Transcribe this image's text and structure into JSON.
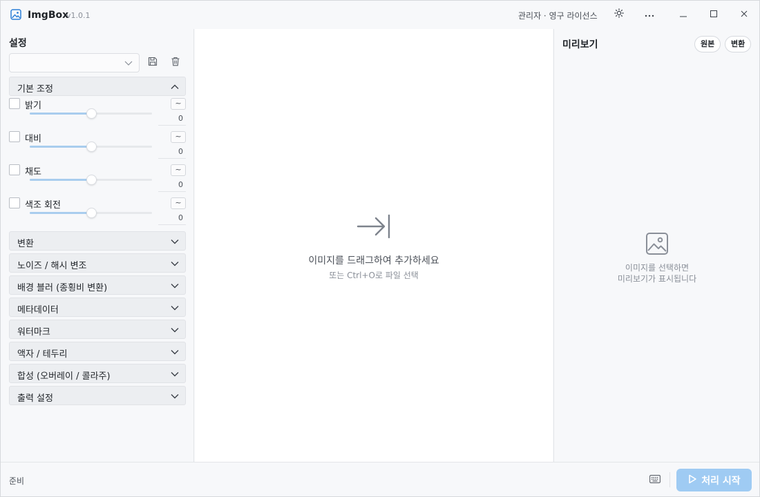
{
  "app": {
    "name": "ImgBox",
    "version": "v1.0.1",
    "license": "관리자 · 영구 라이선스",
    "icons": {
      "app": "image-icon",
      "theme": "sun-icon",
      "more": "more-icon",
      "minimize": "minimize-icon",
      "maximize": "maximize-icon",
      "close": "close-icon"
    }
  },
  "settings": {
    "title": "설정",
    "preset_value": "",
    "adjust_section": {
      "label": "기본 조정",
      "expanded": true,
      "items": [
        {
          "label": "밝기",
          "checked": false,
          "value": "0",
          "level": 0.5,
          "reset": "~"
        },
        {
          "label": "대비",
          "checked": false,
          "value": "0",
          "level": 0.5,
          "reset": "~"
        },
        {
          "label": "채도",
          "checked": false,
          "value": "0",
          "level": 0.5,
          "reset": "~"
        },
        {
          "label": "색조 회전",
          "checked": false,
          "value": "0",
          "level": 0.5,
          "reset": "~"
        }
      ]
    },
    "sections": [
      {
        "label": "변환"
      },
      {
        "label": "노이즈 / 해시 변조"
      },
      {
        "label": "배경 블러 (종횡비 변환)"
      },
      {
        "label": "메타데이터"
      },
      {
        "label": "워터마크"
      },
      {
        "label": "액자 / 테두리"
      },
      {
        "label": "합성 (오버레이 / 콜라주)"
      },
      {
        "label": "출력 설정"
      }
    ]
  },
  "dropzone": {
    "title": "이미지를 드래그하여 추가하세요",
    "subtitle": "또는 Ctrl+O로 파일 선택"
  },
  "preview": {
    "title": "미리보기",
    "original_label": "원본",
    "converted_label": "변환",
    "empty_line1": "이미지를 선택하면",
    "empty_line2": "미리보기가 표시됩니다"
  },
  "statusbar": {
    "status": "준비",
    "start_label": "처리 시작"
  },
  "colors": {
    "accent": "#9fcbf3",
    "slider_fill": "#a9cdee",
    "app_icon": "#2b7fd8"
  }
}
